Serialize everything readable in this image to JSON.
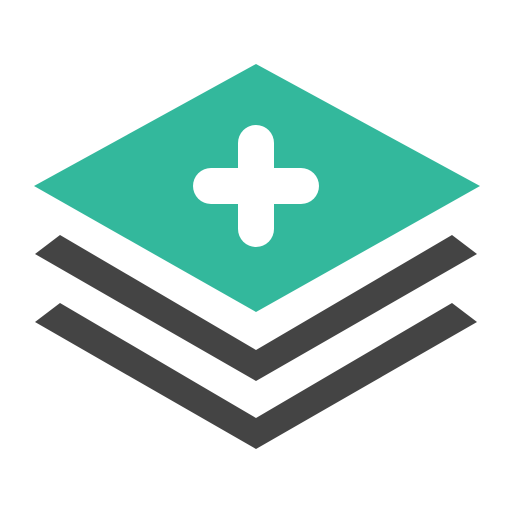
{
  "icon": {
    "name": "add-layer-icon",
    "description_colors": {
      "top_layer": "#33b89c",
      "lower_layers": "#444444",
      "plus_sign": "#ffffff",
      "background": "#ffffff"
    }
  }
}
